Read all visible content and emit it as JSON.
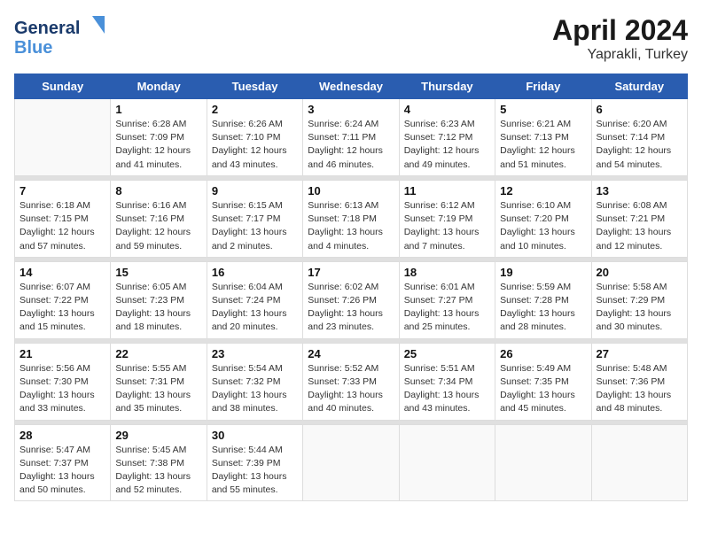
{
  "header": {
    "logo_general": "General",
    "logo_blue": "Blue",
    "month_year": "April 2024",
    "location": "Yaprakli, Turkey"
  },
  "weekdays": [
    "Sunday",
    "Monday",
    "Tuesday",
    "Wednesday",
    "Thursday",
    "Friday",
    "Saturday"
  ],
  "weeks": [
    [
      {
        "day": "",
        "sunrise": "",
        "sunset": "",
        "daylight": ""
      },
      {
        "day": "1",
        "sunrise": "Sunrise: 6:28 AM",
        "sunset": "Sunset: 7:09 PM",
        "daylight": "Daylight: 12 hours and 41 minutes."
      },
      {
        "day": "2",
        "sunrise": "Sunrise: 6:26 AM",
        "sunset": "Sunset: 7:10 PM",
        "daylight": "Daylight: 12 hours and 43 minutes."
      },
      {
        "day": "3",
        "sunrise": "Sunrise: 6:24 AM",
        "sunset": "Sunset: 7:11 PM",
        "daylight": "Daylight: 12 hours and 46 minutes."
      },
      {
        "day": "4",
        "sunrise": "Sunrise: 6:23 AM",
        "sunset": "Sunset: 7:12 PM",
        "daylight": "Daylight: 12 hours and 49 minutes."
      },
      {
        "day": "5",
        "sunrise": "Sunrise: 6:21 AM",
        "sunset": "Sunset: 7:13 PM",
        "daylight": "Daylight: 12 hours and 51 minutes."
      },
      {
        "day": "6",
        "sunrise": "Sunrise: 6:20 AM",
        "sunset": "Sunset: 7:14 PM",
        "daylight": "Daylight: 12 hours and 54 minutes."
      }
    ],
    [
      {
        "day": "7",
        "sunrise": "Sunrise: 6:18 AM",
        "sunset": "Sunset: 7:15 PM",
        "daylight": "Daylight: 12 hours and 57 minutes."
      },
      {
        "day": "8",
        "sunrise": "Sunrise: 6:16 AM",
        "sunset": "Sunset: 7:16 PM",
        "daylight": "Daylight: 12 hours and 59 minutes."
      },
      {
        "day": "9",
        "sunrise": "Sunrise: 6:15 AM",
        "sunset": "Sunset: 7:17 PM",
        "daylight": "Daylight: 13 hours and 2 minutes."
      },
      {
        "day": "10",
        "sunrise": "Sunrise: 6:13 AM",
        "sunset": "Sunset: 7:18 PM",
        "daylight": "Daylight: 13 hours and 4 minutes."
      },
      {
        "day": "11",
        "sunrise": "Sunrise: 6:12 AM",
        "sunset": "Sunset: 7:19 PM",
        "daylight": "Daylight: 13 hours and 7 minutes."
      },
      {
        "day": "12",
        "sunrise": "Sunrise: 6:10 AM",
        "sunset": "Sunset: 7:20 PM",
        "daylight": "Daylight: 13 hours and 10 minutes."
      },
      {
        "day": "13",
        "sunrise": "Sunrise: 6:08 AM",
        "sunset": "Sunset: 7:21 PM",
        "daylight": "Daylight: 13 hours and 12 minutes."
      }
    ],
    [
      {
        "day": "14",
        "sunrise": "Sunrise: 6:07 AM",
        "sunset": "Sunset: 7:22 PM",
        "daylight": "Daylight: 13 hours and 15 minutes."
      },
      {
        "day": "15",
        "sunrise": "Sunrise: 6:05 AM",
        "sunset": "Sunset: 7:23 PM",
        "daylight": "Daylight: 13 hours and 18 minutes."
      },
      {
        "day": "16",
        "sunrise": "Sunrise: 6:04 AM",
        "sunset": "Sunset: 7:24 PM",
        "daylight": "Daylight: 13 hours and 20 minutes."
      },
      {
        "day": "17",
        "sunrise": "Sunrise: 6:02 AM",
        "sunset": "Sunset: 7:26 PM",
        "daylight": "Daylight: 13 hours and 23 minutes."
      },
      {
        "day": "18",
        "sunrise": "Sunrise: 6:01 AM",
        "sunset": "Sunset: 7:27 PM",
        "daylight": "Daylight: 13 hours and 25 minutes."
      },
      {
        "day": "19",
        "sunrise": "Sunrise: 5:59 AM",
        "sunset": "Sunset: 7:28 PM",
        "daylight": "Daylight: 13 hours and 28 minutes."
      },
      {
        "day": "20",
        "sunrise": "Sunrise: 5:58 AM",
        "sunset": "Sunset: 7:29 PM",
        "daylight": "Daylight: 13 hours and 30 minutes."
      }
    ],
    [
      {
        "day": "21",
        "sunrise": "Sunrise: 5:56 AM",
        "sunset": "Sunset: 7:30 PM",
        "daylight": "Daylight: 13 hours and 33 minutes."
      },
      {
        "day": "22",
        "sunrise": "Sunrise: 5:55 AM",
        "sunset": "Sunset: 7:31 PM",
        "daylight": "Daylight: 13 hours and 35 minutes."
      },
      {
        "day": "23",
        "sunrise": "Sunrise: 5:54 AM",
        "sunset": "Sunset: 7:32 PM",
        "daylight": "Daylight: 13 hours and 38 minutes."
      },
      {
        "day": "24",
        "sunrise": "Sunrise: 5:52 AM",
        "sunset": "Sunset: 7:33 PM",
        "daylight": "Daylight: 13 hours and 40 minutes."
      },
      {
        "day": "25",
        "sunrise": "Sunrise: 5:51 AM",
        "sunset": "Sunset: 7:34 PM",
        "daylight": "Daylight: 13 hours and 43 minutes."
      },
      {
        "day": "26",
        "sunrise": "Sunrise: 5:49 AM",
        "sunset": "Sunset: 7:35 PM",
        "daylight": "Daylight: 13 hours and 45 minutes."
      },
      {
        "day": "27",
        "sunrise": "Sunrise: 5:48 AM",
        "sunset": "Sunset: 7:36 PM",
        "daylight": "Daylight: 13 hours and 48 minutes."
      }
    ],
    [
      {
        "day": "28",
        "sunrise": "Sunrise: 5:47 AM",
        "sunset": "Sunset: 7:37 PM",
        "daylight": "Daylight: 13 hours and 50 minutes."
      },
      {
        "day": "29",
        "sunrise": "Sunrise: 5:45 AM",
        "sunset": "Sunset: 7:38 PM",
        "daylight": "Daylight: 13 hours and 52 minutes."
      },
      {
        "day": "30",
        "sunrise": "Sunrise: 5:44 AM",
        "sunset": "Sunset: 7:39 PM",
        "daylight": "Daylight: 13 hours and 55 minutes."
      },
      {
        "day": "",
        "sunrise": "",
        "sunset": "",
        "daylight": ""
      },
      {
        "day": "",
        "sunrise": "",
        "sunset": "",
        "daylight": ""
      },
      {
        "day": "",
        "sunrise": "",
        "sunset": "",
        "daylight": ""
      },
      {
        "day": "",
        "sunrise": "",
        "sunset": "",
        "daylight": ""
      }
    ]
  ]
}
